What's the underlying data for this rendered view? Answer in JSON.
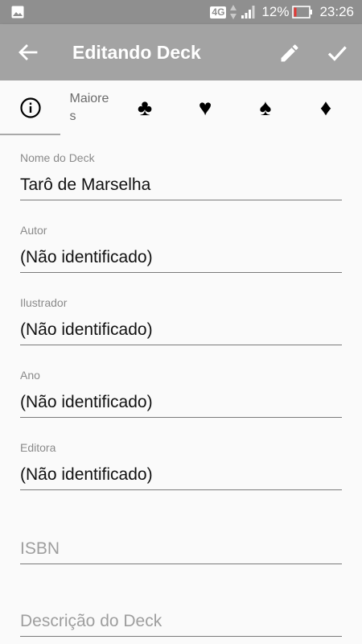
{
  "status_bar": {
    "network": "4G",
    "battery_percent": "12%",
    "time": "23:26",
    "icons": [
      "gallery-icon",
      "data-arrows-icon",
      "signal-icon",
      "battery-icon"
    ]
  },
  "app_bar": {
    "title": "Editando Deck",
    "icons": [
      "back-arrow-icon",
      "pencil-icon",
      "check-icon"
    ]
  },
  "tabs": {
    "items": [
      {
        "type": "icon",
        "icon": "info-icon",
        "active": true
      },
      {
        "type": "text",
        "label": "Maiores"
      },
      {
        "type": "suit",
        "symbol": "♣",
        "icon": "clubs-icon"
      },
      {
        "type": "suit",
        "symbol": "♥",
        "icon": "hearts-icon"
      },
      {
        "type": "suit",
        "symbol": "♠",
        "icon": "spades-icon"
      },
      {
        "type": "suit",
        "symbol": "♦",
        "icon": "diamonds-icon"
      }
    ]
  },
  "form": {
    "deck_name": {
      "label": "Nome do Deck",
      "value": "Tarô de Marselha"
    },
    "author": {
      "label": "Autor",
      "value": "(Não identificado)"
    },
    "illustrator": {
      "label": "Ilustrador",
      "value": "(Não identificado)"
    },
    "year": {
      "label": "Ano",
      "value": "(Não identificado)"
    },
    "publisher": {
      "label": "Editora",
      "value": "(Não identificado)"
    },
    "isbn": {
      "placeholder": "ISBN",
      "value": ""
    },
    "description": {
      "placeholder": "Descrição do Deck",
      "value": ""
    }
  },
  "colors": {
    "status_bar": "#8f8f8f",
    "app_bar": "#a3a3a3",
    "background": "#fafafa",
    "label": "#8a8a8a",
    "text": "#111111"
  }
}
